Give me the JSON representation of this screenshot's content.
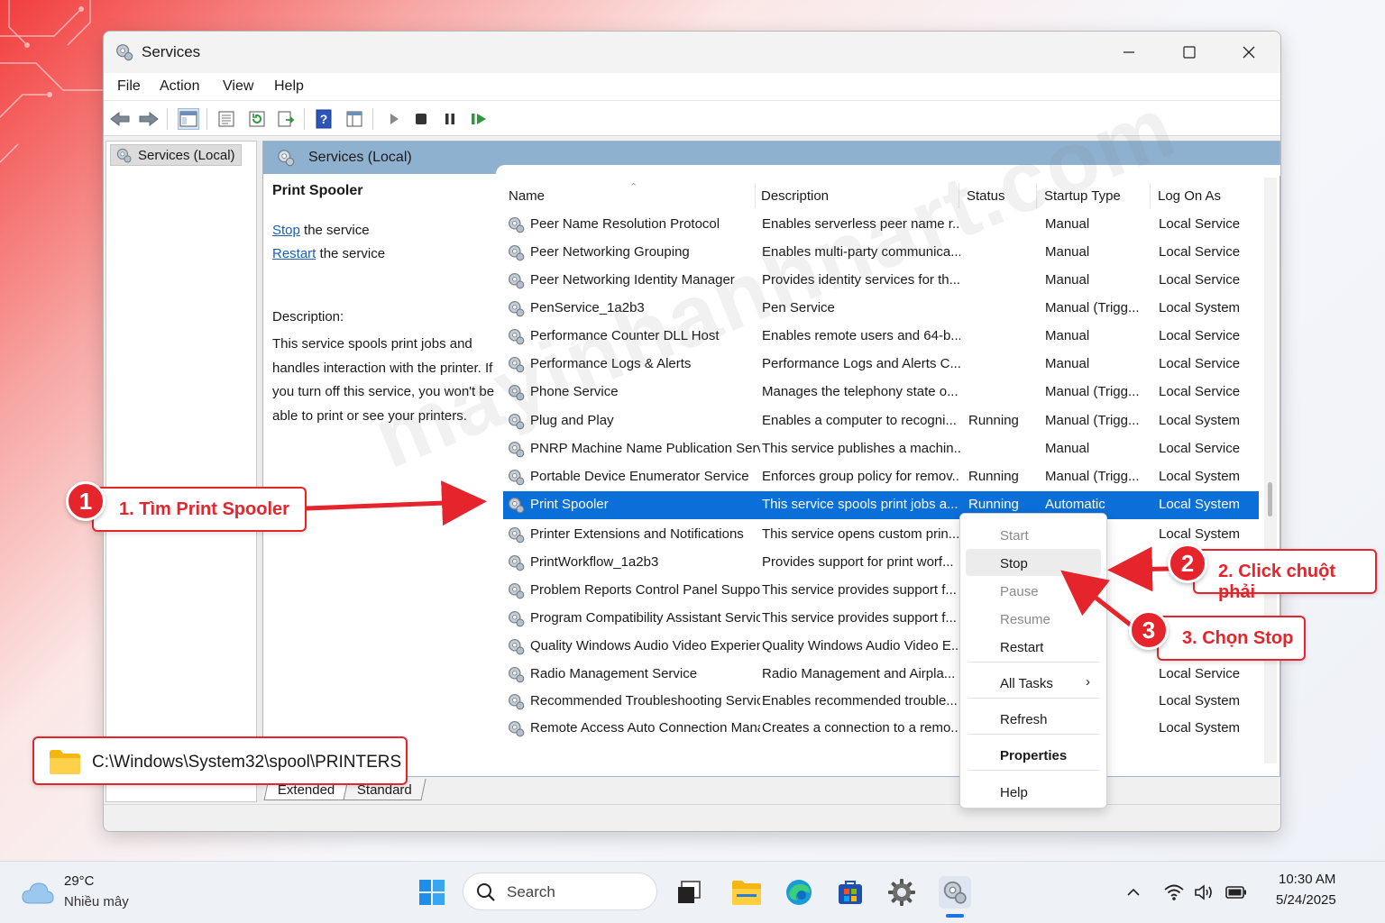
{
  "window": {
    "title": "Services"
  },
  "menu": [
    "File",
    "Action",
    "View",
    "Help"
  ],
  "tree": {
    "root": "Services (Local)"
  },
  "pane_header": "Services (Local)",
  "detail": {
    "title": "Print Spooler",
    "stop_link": "Stop",
    "stop_rest": " the service",
    "restart_link": "Restart",
    "restart_rest": " the service",
    "desc_label": "Description:",
    "desc_text": "This service spools print jobs and handles interaction with the printer. If you turn off this service, you won't be able to print or see your printers."
  },
  "columns": [
    "Name",
    "Description",
    "Status",
    "Startup Type",
    "Log On As"
  ],
  "rows": [
    {
      "name": "Peer Name Resolution Protocol",
      "desc": "Enables serverless peer name r...",
      "status": "",
      "startup": "Manual",
      "logon": "Local Service"
    },
    {
      "name": "Peer Networking Grouping",
      "desc": "Enables multi-party communica...",
      "status": "",
      "startup": "Manual",
      "logon": "Local Service"
    },
    {
      "name": "Peer Networking Identity Manager",
      "desc": "Provides identity services for th...",
      "status": "",
      "startup": "Manual",
      "logon": "Local Service"
    },
    {
      "name": "PenService_1a2b3",
      "desc": "Pen Service",
      "status": "",
      "startup": "Manual (Trigg...",
      "logon": "Local System"
    },
    {
      "name": "Performance Counter DLL Host",
      "desc": "Enables remote users and 64-b...",
      "status": "",
      "startup": "Manual",
      "logon": "Local Service"
    },
    {
      "name": "Performance Logs & Alerts",
      "desc": "Performance Logs and Alerts C...",
      "status": "",
      "startup": "Manual",
      "logon": "Local Service"
    },
    {
      "name": "Phone Service",
      "desc": "Manages the telephony state o...",
      "status": "",
      "startup": "Manual (Trigg...",
      "logon": "Local Service"
    },
    {
      "name": "Plug and Play",
      "desc": "Enables a computer to recogni...",
      "status": "Running",
      "startup": "Manual (Trigg...",
      "logon": "Local System"
    },
    {
      "name": "PNRP Machine Name Publication Service",
      "desc": "This service publishes a machin...",
      "status": "",
      "startup": "Manual",
      "logon": "Local Service"
    },
    {
      "name": "Portable Device Enumerator Service",
      "desc": "Enforces group policy for remov...",
      "status": "Running",
      "startup": "Manual (Trigg...",
      "logon": "Local System"
    },
    {
      "name": "Print Spooler",
      "desc": "This service spools print jobs a...",
      "status": "Running",
      "startup": "Automatic",
      "logon": "Local System",
      "selected": true
    },
    {
      "name": "Printer Extensions and Notifications",
      "desc": "This service opens custom prin...",
      "status": "",
      "startup": "",
      "logon": "Local System"
    },
    {
      "name": "PrintWorkflow_1a2b3",
      "desc": "Provides support for print worf...",
      "status": "",
      "startup": "",
      "logon": ""
    },
    {
      "name": "Problem Reports Control Panel Support",
      "desc": "This service provides support f...",
      "status": "",
      "startup": "",
      "logon": ""
    },
    {
      "name": "Program Compatibility Assistant Service",
      "desc": "This service provides support f...",
      "status": "",
      "startup": "",
      "logon": ""
    },
    {
      "name": "Quality Windows Audio Video Experience",
      "desc": "Quality Windows Audio Video E...",
      "status": "",
      "startup": "",
      "logon": ""
    },
    {
      "name": "Radio Management Service",
      "desc": "Radio Management and Airpla...",
      "status": "",
      "startup": "",
      "logon": "Local Service"
    },
    {
      "name": "Recommended Troubleshooting Service",
      "desc": "Enables recommended trouble...",
      "status": "",
      "startup": "",
      "logon": "Local System"
    },
    {
      "name": "Remote Access Auto Connection Manager",
      "desc": "Creates a connection to a remo...",
      "status": "",
      "startup": "",
      "logon": "Local System"
    }
  ],
  "tabs": [
    "Extended",
    "Standard"
  ],
  "context_menu": {
    "start": "Start",
    "stop": "Stop",
    "pause": "Pause",
    "resume": "Resume",
    "restart": "Restart",
    "all_tasks": "All Tasks",
    "refresh": "Refresh",
    "properties": "Properties",
    "help": "Help"
  },
  "annotations": {
    "step1_num": "1",
    "step1_text": "1. Tìm Print Spooler",
    "step2_num": "2",
    "step2_text": "2. Click chuột phải",
    "step3_num": "3",
    "step3_text": "3. Chọn Stop",
    "path": "C:\\Windows\\System32\\spool\\PRINTERS",
    "watermark": "mayinhanhnart.com",
    "accent": "#e6242b"
  },
  "taskbar": {
    "temp": "29°C",
    "weather": "Nhiều mây",
    "search": "Search",
    "time": "10:30 AM",
    "date": "5/24/2025"
  }
}
